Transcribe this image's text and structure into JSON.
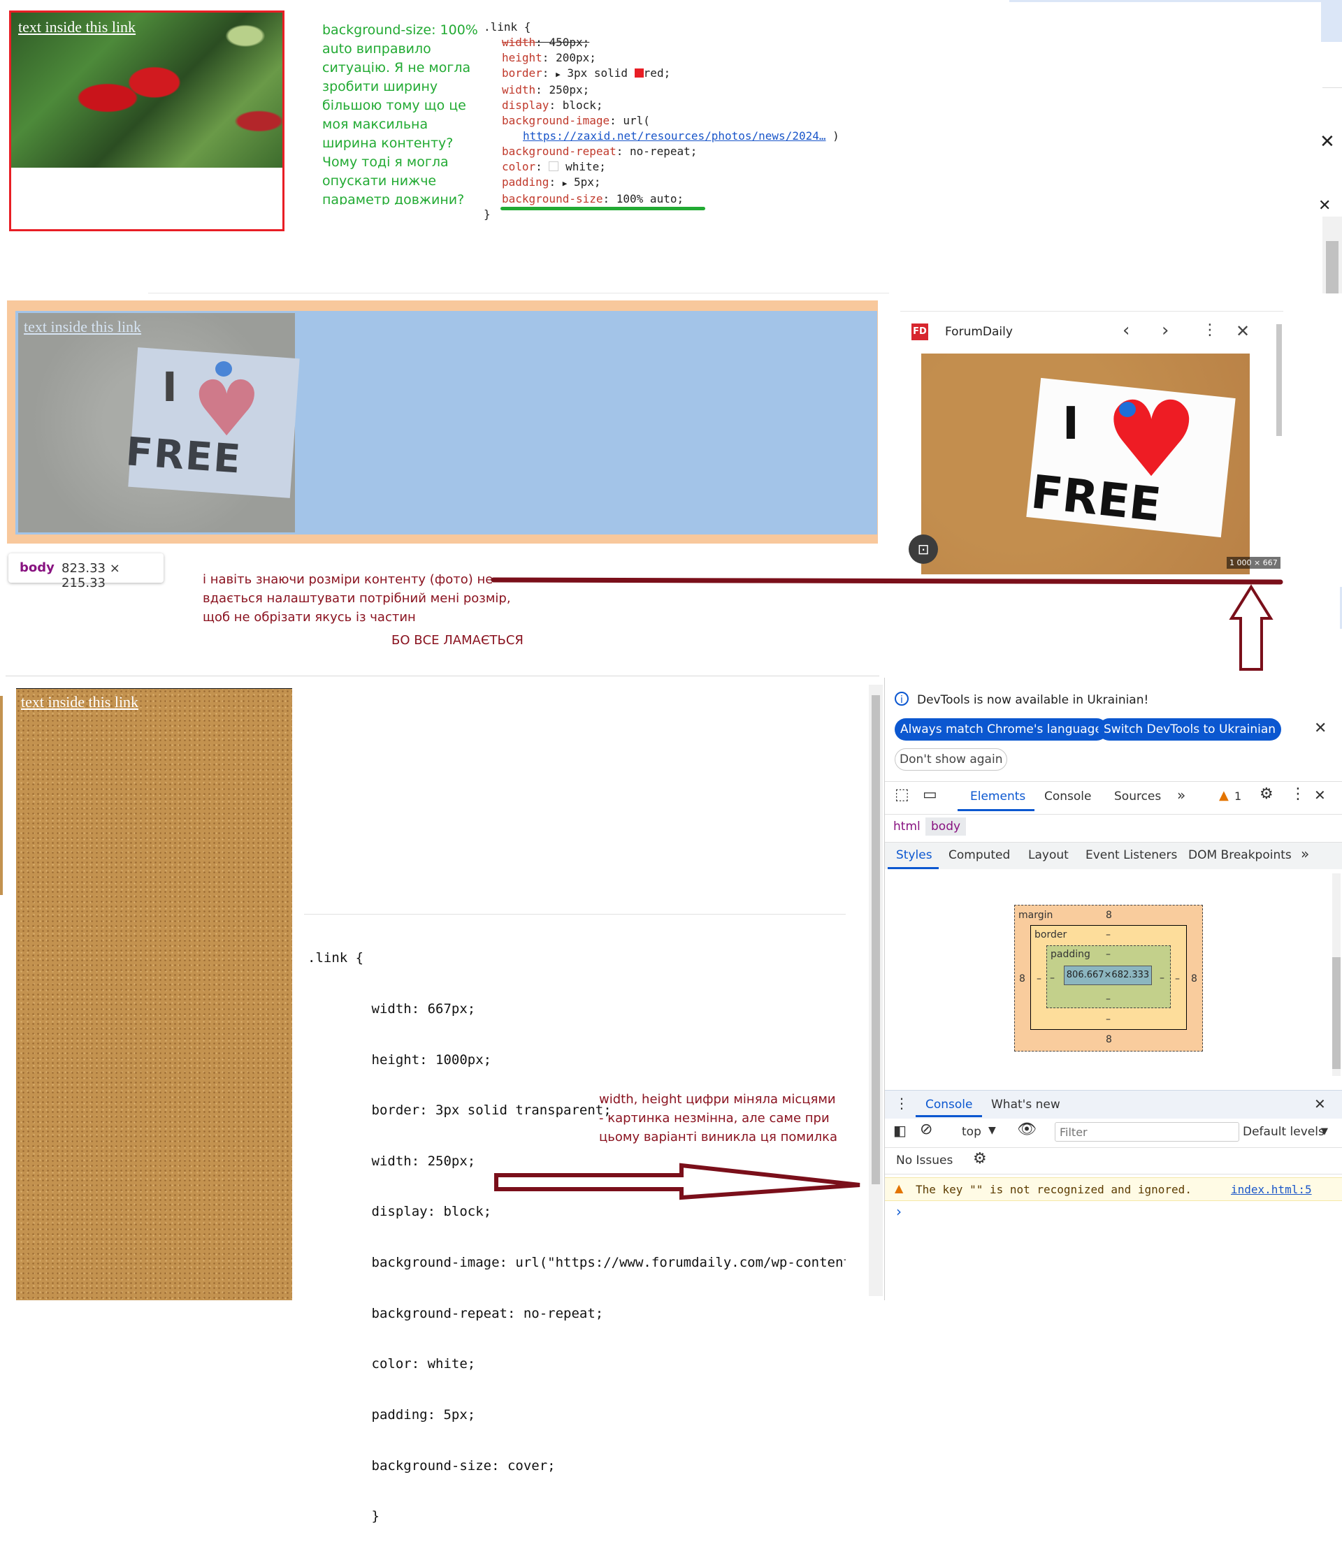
{
  "top_example": {
    "link_text": "text inside this link",
    "note_lines": [
      "background-size: 100%",
      "auto виправило",
      "ситуацію. Я не могла",
      "зробити ширину",
      "більшою тому що це",
      "моя максильна",
      "ширина контенту?",
      "Чому тоді я могла",
      "опускати нижче",
      "параметр довжини?"
    ],
    "css": {
      "selector": ".link {",
      "close": "}",
      "rules": [
        {
          "prop": "width",
          "value": "450px;"
        },
        {
          "prop": "height",
          "value": "200px;"
        },
        {
          "prop": "border",
          "value": "3px solid",
          "value2": "red;"
        },
        {
          "prop": "width",
          "value": "250px;"
        },
        {
          "prop": "display",
          "value": "block;"
        },
        {
          "prop": "background-image",
          "value": "url("
        },
        {
          "prop": "",
          "value": "https://zaxid.net/resources/photos/news/2024…",
          "value2": ")"
        },
        {
          "prop": "background-repeat",
          "value": "no-repeat;"
        },
        {
          "prop": "color",
          "value": "white;"
        },
        {
          "prop": "padding",
          "value": "5px;"
        },
        {
          "prop": "background-size",
          "value": "100% auto;"
        }
      ]
    },
    "colors": {
      "border": "#e81e25",
      "note": "#22aa33",
      "underline": "#22aa33"
    }
  },
  "middle_example": {
    "link_text": "text inside this link",
    "image_i": "I",
    "image_heart": "♥",
    "image_free": "FREE",
    "tooltip_tag": "body",
    "tooltip_size": "823.33 × 215.33",
    "note_lines": [
      "і навіть знаючи розміри контенту (фото) не",
      "вдається налаштувати потрібний мені розмір,",
      "щоб не обрізати якусь із частин"
    ],
    "note_caps": "БО ВСЕ ЛАМАЄТЬСЯ"
  },
  "preview_panel": {
    "site_name": "ForumDaily",
    "logo": "FD",
    "image_size": "1 000 × 667",
    "image_i": "I",
    "image_free": "FREE",
    "heart": "♥",
    "icons": [
      "chevron-left-icon",
      "chevron-right-icon",
      "more-vert-icon",
      "close-icon",
      "lens-icon"
    ]
  },
  "bottom_example": {
    "link_text": "text inside this link",
    "css_lines": [
      ".link {",
      "        width: 667px;",
      "        height: 1000px;",
      "        border: 3px solid transparent;",
      "        width: 250px;",
      "        display: block;",
      "        background-image: url(\"https://www.forumdaily.com/wp-content",
      "        background-repeat: no-repeat;",
      "        color: white;",
      "        padding: 5px;",
      "        background-size: cover;",
      "        }"
    ],
    "note_lines": [
      "width, height цифри міняла місцями",
      "- картинка незмінна, але саме при",
      "цьому варіанті виникла ця помилка"
    ],
    "colors": {
      "note": "#8a1320",
      "arrow": "#7a0f1a"
    }
  },
  "devtools": {
    "notice": "DevTools is now available in Ukrainian!",
    "btn_match": "Always match Chrome's language",
    "btn_switch": "Switch DevTools to Ukrainian",
    "btn_dont": "Don't show again",
    "main_tabs": [
      "Elements",
      "Console",
      "Sources"
    ],
    "warning_count": "1",
    "breadcrumbs": [
      "html",
      "body"
    ],
    "sub_tabs": [
      "Styles",
      "Computed",
      "Layout",
      "Event Listeners",
      "DOM Breakpoints"
    ],
    "box_model": {
      "margin_label": "margin",
      "margin_top": "8",
      "margin_bottom": "8",
      "margin_left": "8",
      "margin_right": "8",
      "border_label": "border",
      "border_top": "–",
      "border_bottom": "–",
      "border_left": "–",
      "border_right": "–",
      "padding_label": "padding",
      "padding_top": "–",
      "padding_bottom": "–",
      "padding_left": "–",
      "padding_right": "–",
      "content": "806.667×682.333"
    },
    "drawer_tabs": [
      "Console",
      "What's new"
    ],
    "context": "top",
    "filter_placeholder": "Filter",
    "levels": "Default levels",
    "no_issues": "No Issues",
    "warning_message": "The key \"\" is not recognized and ignored.",
    "warning_source": "index.html:5",
    "prompt": "›",
    "colors": {
      "accent": "#0b57d0",
      "warning_bg": "#fffbe5"
    }
  }
}
